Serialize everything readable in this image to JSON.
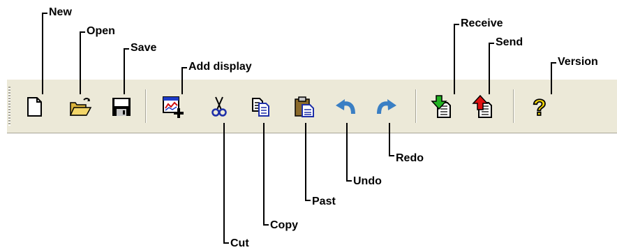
{
  "toolbar": {
    "buttons": [
      {
        "id": "new",
        "icon": "new-document-icon"
      },
      {
        "id": "open",
        "icon": "open-folder-icon"
      },
      {
        "id": "save",
        "icon": "floppy-disk-icon"
      },
      {
        "id": "add_display",
        "icon": "add-display-icon"
      },
      {
        "id": "cut",
        "icon": "scissors-icon"
      },
      {
        "id": "copy",
        "icon": "copy-icon"
      },
      {
        "id": "paste",
        "icon": "clipboard-icon"
      },
      {
        "id": "undo",
        "icon": "undo-arrow-icon"
      },
      {
        "id": "redo",
        "icon": "redo-arrow-icon"
      },
      {
        "id": "receive",
        "icon": "receive-icon"
      },
      {
        "id": "send",
        "icon": "send-icon"
      },
      {
        "id": "version",
        "icon": "question-mark-icon"
      }
    ]
  },
  "labels": {
    "new": "New",
    "open": "Open",
    "save": "Save",
    "add_display": "Add display",
    "receive": "Receive",
    "send": "Send",
    "version": "Version",
    "redo": "Redo",
    "undo": "Undo",
    "past": "Past",
    "copy": "Copy",
    "cut": "Cut"
  },
  "colors": {
    "toolbar_bg": "#ece9d8",
    "arrow_blue": "#3a7fc4",
    "receive_green": "#22b322",
    "send_red": "#e01010",
    "question_yellow": "#f5d800"
  }
}
